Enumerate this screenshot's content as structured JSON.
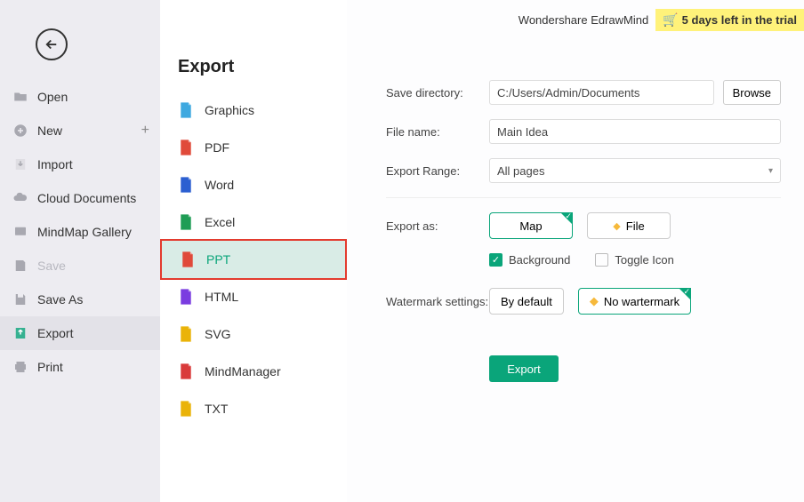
{
  "header": {
    "brand": "Wondershare EdrawMind",
    "trial_text": "5 days left in the trial"
  },
  "left_menu": {
    "items": [
      {
        "label": "Open",
        "disabled": false
      },
      {
        "label": "New",
        "disabled": false,
        "plus": true
      },
      {
        "label": "Import",
        "disabled": false
      },
      {
        "label": "Cloud Documents",
        "disabled": false
      },
      {
        "label": "MindMap Gallery",
        "disabled": false
      },
      {
        "label": "Save",
        "disabled": true
      },
      {
        "label": "Save As",
        "disabled": false
      },
      {
        "label": "Export",
        "disabled": false,
        "active": true
      },
      {
        "label": "Print",
        "disabled": false
      }
    ]
  },
  "panel": {
    "title": "Export",
    "formats": [
      {
        "label": "Graphics",
        "color": "#3fa9e0"
      },
      {
        "label": "PDF",
        "color": "#e04a3a"
      },
      {
        "label": "Word",
        "color": "#2b5fd1"
      },
      {
        "label": "Excel",
        "color": "#1f9d55"
      },
      {
        "label": "PPT",
        "color": "#e04a3a",
        "selected": true
      },
      {
        "label": "HTML",
        "color": "#7a3ce0"
      },
      {
        "label": "SVG",
        "color": "#eab308"
      },
      {
        "label": "MindManager",
        "color": "#d93a3a"
      },
      {
        "label": "TXT",
        "color": "#eab308"
      }
    ]
  },
  "settings": {
    "save_dir_label": "Save directory:",
    "save_dir_value": "C:/Users/Admin/Documents",
    "browse_label": "Browse",
    "file_name_label": "File name:",
    "file_name_value": "Main Idea",
    "export_range_label": "Export Range:",
    "export_range_value": "All pages",
    "export_as_label": "Export as:",
    "export_as_map": "Map",
    "export_as_file": "File",
    "background_label": "Background",
    "toggle_icon_label": "Toggle Icon",
    "watermark_label": "Watermark settings:",
    "watermark_default": "By default",
    "watermark_none": "No wartermark",
    "export_button": "Export"
  }
}
